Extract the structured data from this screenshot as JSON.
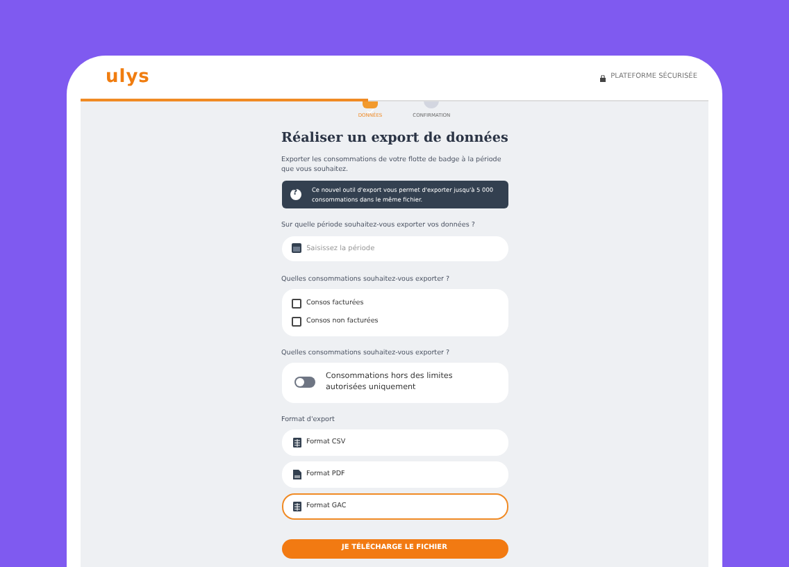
{
  "header": {
    "logo": "ulys",
    "secure_label": "PLATEFORME SÉCURISÉE"
  },
  "steps": [
    {
      "label": "DONNÉES",
      "selected": true
    },
    {
      "label": "CONFIRMATION",
      "selected": false
    }
  ],
  "title": "Réaliser un export de données",
  "description": "Exporter les consommations de votre flotte de badge à la période que vous souhaitez.",
  "info_icon": "?",
  "info": "Ce nouvel outil d'export vous permet d'exporter jusqu'à 5 000 consommations dans le même fichier.",
  "period": {
    "question": "Sur quelle période souhaitez-vous exporter vos données ?",
    "placeholder": "Saisissez la période"
  },
  "consumptions": {
    "question": "Quelles consommations souhaitez-vous exporter ?",
    "options": [
      {
        "label": "Consos facturées",
        "checked": false
      },
      {
        "label": "Consos non facturées",
        "checked": false
      }
    ]
  },
  "limits": {
    "question": "Quelles consommations souhaitez-vous exporter ?",
    "label": "Consommations hors des limites autorisées uniquement",
    "on": false
  },
  "format": {
    "question": "Format d'export",
    "options": [
      {
        "label": "Format CSV",
        "kind": "table",
        "selected": false
      },
      {
        "label": "Format PDF",
        "kind": "file",
        "selected": false
      },
      {
        "label": "Format GAC",
        "kind": "table",
        "selected": true
      }
    ]
  },
  "submit": "JE TÉLÉCHARGE LE FICHIER"
}
